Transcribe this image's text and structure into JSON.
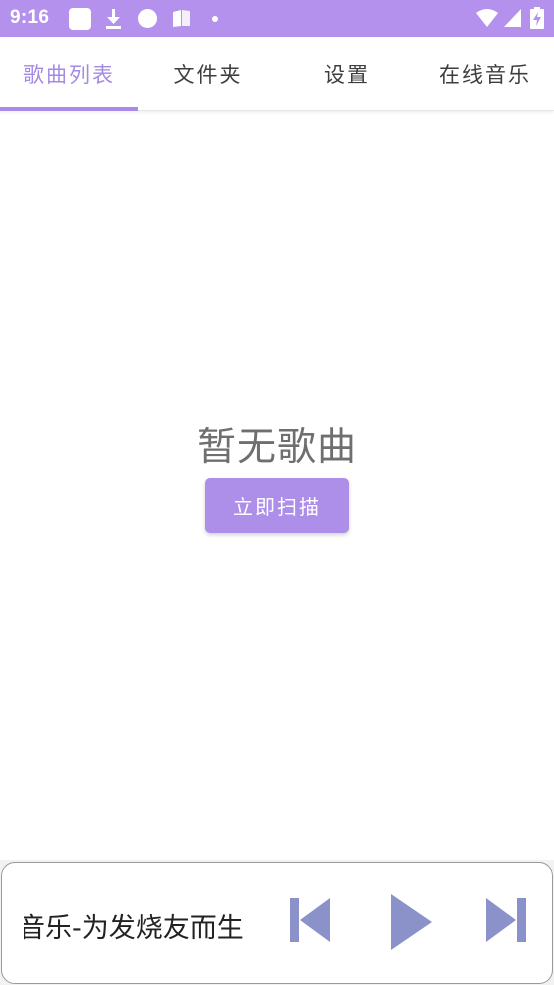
{
  "status_bar": {
    "time": "9:16",
    "icons": [
      "app-square-icon",
      "download-icon",
      "circle-icon",
      "book-icon",
      "dot-icon",
      "wifi-icon",
      "signal-icon",
      "battery-charging-icon"
    ]
  },
  "tabs": [
    {
      "label": "歌曲列表",
      "active": true
    },
    {
      "label": "文件夹",
      "active": false
    },
    {
      "label": "设置",
      "active": false
    },
    {
      "label": "在线音乐",
      "active": false
    }
  ],
  "empty_state": {
    "title": "暂无歌曲",
    "scan_button_label": "立即扫描"
  },
  "player": {
    "track_text": "音乐-为发烧友而生",
    "controls": [
      "skip-previous-icon",
      "play-icon",
      "skip-next-icon"
    ]
  },
  "colors": {
    "status_bar": "#b491ec",
    "accent": "#a98ae9",
    "button": "#ad8ee8",
    "player_icons": "#8a92c9"
  }
}
